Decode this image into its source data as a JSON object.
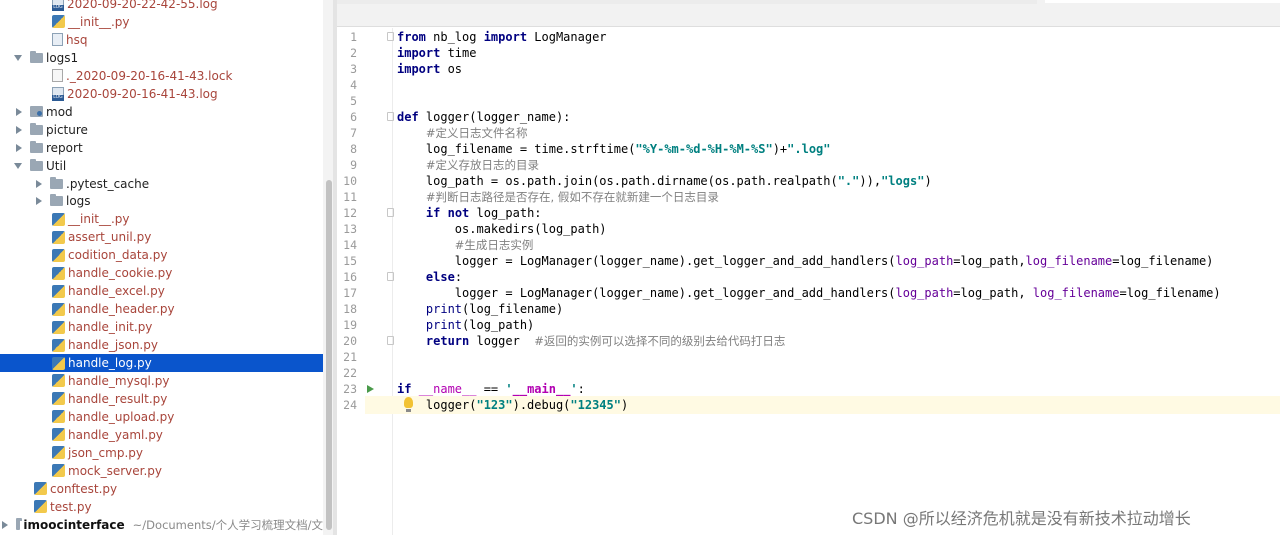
{
  "project_tree": {
    "items": [
      {
        "label": "2020-09-20-22-42-55.log",
        "icon": "log-file-icon",
        "style": "red"
      },
      {
        "label": "__init__.py",
        "icon": "python-file-icon",
        "style": "red"
      },
      {
        "label": "hsq",
        "icon": "file-icon",
        "style": "red"
      },
      {
        "label": "logs1",
        "icon": "folder-icon",
        "style": "normal"
      },
      {
        "label": "._2020-09-20-16-41-43.lock",
        "icon": "file-icon",
        "style": "red"
      },
      {
        "label": "2020-09-20-16-41-43.log",
        "icon": "log-file-icon",
        "style": "red"
      },
      {
        "label": "mod",
        "icon": "package-folder-icon",
        "style": "normal"
      },
      {
        "label": "picture",
        "icon": "folder-icon",
        "style": "normal"
      },
      {
        "label": "report",
        "icon": "folder-icon",
        "style": "normal"
      },
      {
        "label": "Util",
        "icon": "folder-icon",
        "style": "normal"
      },
      {
        "label": ".pytest_cache",
        "icon": "folder-icon",
        "style": "normal"
      },
      {
        "label": "logs",
        "icon": "folder-icon",
        "style": "normal"
      },
      {
        "label": "__init__.py",
        "icon": "python-file-icon",
        "style": "red"
      },
      {
        "label": "assert_unil.py",
        "icon": "python-file-icon",
        "style": "red"
      },
      {
        "label": "codition_data.py",
        "icon": "python-file-icon",
        "style": "red"
      },
      {
        "label": "handle_cookie.py",
        "icon": "python-file-icon",
        "style": "red"
      },
      {
        "label": "handle_excel.py",
        "icon": "python-file-icon",
        "style": "red"
      },
      {
        "label": "handle_header.py",
        "icon": "python-file-icon",
        "style": "red"
      },
      {
        "label": "handle_init.py",
        "icon": "python-file-icon",
        "style": "red"
      },
      {
        "label": "handle_json.py",
        "icon": "python-file-icon",
        "style": "red"
      },
      {
        "label": "handle_log.py",
        "icon": "python-file-icon",
        "style": "selected"
      },
      {
        "label": "handle_mysql.py",
        "icon": "python-file-icon",
        "style": "red"
      },
      {
        "label": "handle_result.py",
        "icon": "python-file-icon",
        "style": "red"
      },
      {
        "label": "handle_upload.py",
        "icon": "python-file-icon",
        "style": "red"
      },
      {
        "label": "handle_yaml.py",
        "icon": "python-file-icon",
        "style": "red"
      },
      {
        "label": "json_cmp.py",
        "icon": "python-file-icon",
        "style": "red"
      },
      {
        "label": "mock_server.py",
        "icon": "python-file-icon",
        "style": "red"
      },
      {
        "label": "conftest.py",
        "icon": "python-file-icon",
        "style": "red"
      },
      {
        "label": "test.py",
        "icon": "python-file-icon",
        "style": "red"
      },
      {
        "label": "imoocinterface",
        "icon": "folder-icon",
        "style": "bold",
        "hint": "~/Documents/个人学习梳理文档/文"
      }
    ]
  },
  "editor": {
    "line_numbers": [
      "1",
      "2",
      "3",
      "4",
      "5",
      "6",
      "7",
      "8",
      "9",
      "10",
      "11",
      "12",
      "13",
      "14",
      "15",
      "16",
      "17",
      "18",
      "19",
      "20",
      "21",
      "22",
      "23",
      "24"
    ],
    "code_lines": [
      "from nb_log import LogManager",
      "import time",
      "import os",
      "",
      "",
      "def logger(logger_name):",
      "    #定义日志文件名称",
      "    log_filename = time.strftime(\"%Y-%m-%d-%H-%M-%S\")+\".log\"",
      "    #定义存放日志的目录",
      "    log_path = os.path.join(os.path.dirname(os.path.realpath(\".\")),\"logs\")",
      "    #判断日志路径是否存在, 假如不存在就新建一个日志目录",
      "    if not log_path:",
      "        os.makedirs(log_path)",
      "        #生成日志实例",
      "        logger = LogManager(logger_name).get_logger_and_add_handlers(log_path=log_path,log_filename=log_filename)",
      "    else:",
      "        logger = LogManager(logger_name).get_logger_and_add_handlers(log_path=log_path, log_filename=log_filename)",
      "    print(log_filename)",
      "    print(log_path)",
      "    return logger  #返回的实例可以选择不同的级别去给代码打日志",
      "",
      "",
      "if __name__ == '__main__':",
      "    logger(\"123\").debug(\"12345\")"
    ]
  },
  "watermark": "CSDN @所以经济危机就是没有新技术拉动增长"
}
